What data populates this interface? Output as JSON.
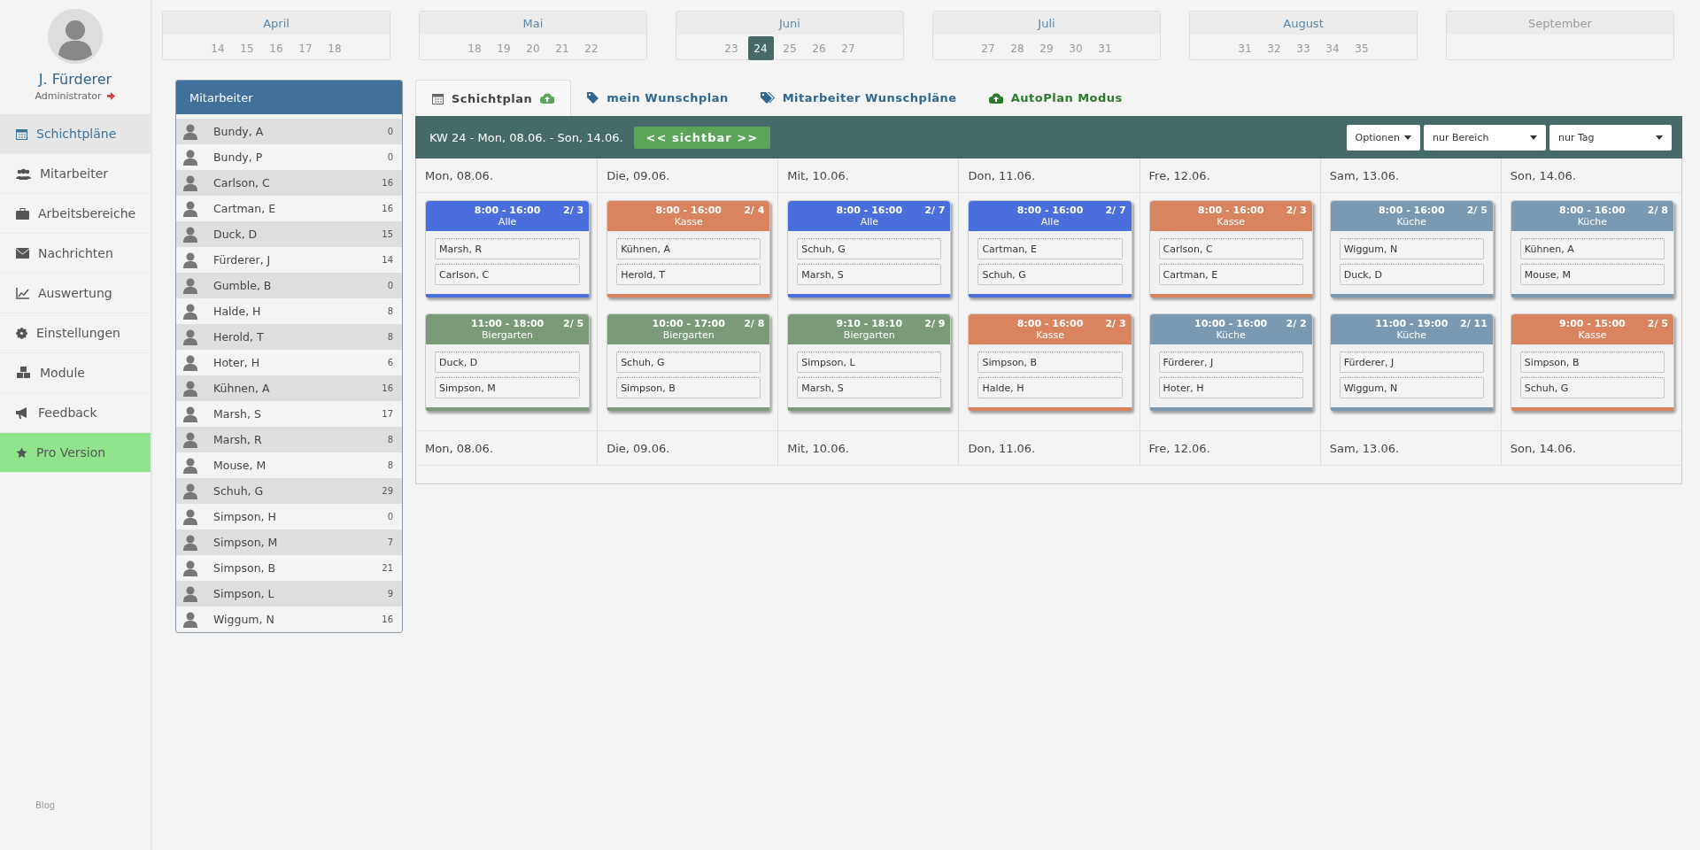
{
  "sidebar": {
    "user": {
      "name": "J. Fürderer",
      "role": "Administrator"
    },
    "nav": [
      {
        "label": "Schichtpläne",
        "selected": true,
        "kind": "normal"
      },
      {
        "label": "Mitarbeiter",
        "selected": false,
        "kind": "normal"
      },
      {
        "label": "Arbeitsbereiche",
        "selected": false,
        "kind": "normal"
      },
      {
        "label": "Nachrichten",
        "selected": false,
        "kind": "normal"
      },
      {
        "label": "Auswertung",
        "selected": false,
        "kind": "normal"
      },
      {
        "label": "Einstellungen",
        "selected": false,
        "kind": "normal"
      },
      {
        "label": "Module",
        "selected": false,
        "kind": "normal"
      },
      {
        "label": "Feedback",
        "selected": false,
        "kind": "normal"
      },
      {
        "label": "Pro Version",
        "selected": false,
        "kind": "promo"
      }
    ],
    "footer_link": "Blog"
  },
  "months": [
    {
      "name": "April",
      "weeks": [
        {
          "label": "14",
          "selected": false
        },
        {
          "label": "15",
          "selected": false
        },
        {
          "label": "16",
          "selected": false
        },
        {
          "label": "17",
          "selected": false
        },
        {
          "label": "18",
          "selected": false
        }
      ]
    },
    {
      "name": "Mai",
      "weeks": [
        {
          "label": "18",
          "selected": false
        },
        {
          "label": "19",
          "selected": false
        },
        {
          "label": "20",
          "selected": false
        },
        {
          "label": "21",
          "selected": false
        },
        {
          "label": "22",
          "selected": false
        }
      ]
    },
    {
      "name": "Juni",
      "weeks": [
        {
          "label": "23",
          "selected": false
        },
        {
          "label": "24",
          "selected": true
        },
        {
          "label": "25",
          "selected": false
        },
        {
          "label": "26",
          "selected": false
        },
        {
          "label": "27",
          "selected": false
        }
      ]
    },
    {
      "name": "Juli",
      "weeks": [
        {
          "label": "27",
          "selected": false
        },
        {
          "label": "28",
          "selected": false
        },
        {
          "label": "29",
          "selected": false
        },
        {
          "label": "30",
          "selected": false
        },
        {
          "label": "31",
          "selected": false
        }
      ]
    },
    {
      "name": "August",
      "weeks": [
        {
          "label": "31",
          "selected": false
        },
        {
          "label": "32",
          "selected": false
        },
        {
          "label": "33",
          "selected": false
        },
        {
          "label": "34",
          "selected": false
        },
        {
          "label": "35",
          "selected": false
        }
      ]
    },
    {
      "name": "September"
    }
  ],
  "staff": {
    "title": "Mitarbeiter",
    "rows": [
      {
        "name": "Bundy, A",
        "count": "0"
      },
      {
        "name": "Bundy, P",
        "count": "0"
      },
      {
        "name": "Carlson, C",
        "count": "16"
      },
      {
        "name": "Cartman, E",
        "count": "16"
      },
      {
        "name": "Duck, D",
        "count": "15"
      },
      {
        "name": "Fürderer, J",
        "count": "14"
      },
      {
        "name": "Gumble, B",
        "count": "0"
      },
      {
        "name": "Halde, H",
        "count": "8"
      },
      {
        "name": "Herold, T",
        "count": "8"
      },
      {
        "name": "Hoter, H",
        "count": "6"
      },
      {
        "name": "Kühnen, A",
        "count": "16"
      },
      {
        "name": "Marsh, S",
        "count": "17"
      },
      {
        "name": "Marsh, R",
        "count": "8"
      },
      {
        "name": "Mouse, M",
        "count": "8"
      },
      {
        "name": "Schuh, G",
        "count": "29"
      },
      {
        "name": "Simpson, H",
        "count": "0"
      },
      {
        "name": "Simpson, M",
        "count": "7"
      },
      {
        "name": "Simpson, B",
        "count": "21"
      },
      {
        "name": "Simpson, L",
        "count": "9"
      },
      {
        "name": "Wiggum, N",
        "count": "16"
      }
    ]
  },
  "tabs": [
    {
      "label": "Schichtplan",
      "selected": true,
      "kind": "view"
    },
    {
      "label": "mein Wunschplan",
      "selected": false,
      "kind": "view"
    },
    {
      "label": "Mitarbeiter Wunschpläne",
      "selected": false,
      "kind": "view"
    },
    {
      "label": "AutoPlan Modus",
      "selected": false,
      "kind": "action"
    }
  ],
  "toolbar": {
    "week": "KW 24 - Mon, 08.06. - Son, 14.06.",
    "visibility_button": "<< sichtbar >>",
    "options_button": "Optionen",
    "area_filter": "nur Bereich",
    "day_filter": "nur Tag"
  },
  "days": [
    {
      "header": "Mon, 08.06.",
      "footer": "Mon, 08.06.",
      "shifts": [
        {
          "time": "8:00 - 16:00",
          "count": "2/ 3",
          "area": "Alle",
          "color": "#4a6fdc",
          "staff": [
            "Marsh, R",
            "Carlson, C"
          ]
        },
        {
          "time": "11:00 - 18:00",
          "count": "2/ 5",
          "area": "Biergarten",
          "color": "#7b9a7a",
          "staff": [
            "Duck, D",
            "Simpson, M"
          ]
        }
      ]
    },
    {
      "header": "Die, 09.06.",
      "footer": "Die, 09.06.",
      "shifts": [
        {
          "time": "8:00 - 16:00",
          "count": "2/ 4",
          "area": "Kasse",
          "color": "#d9845e",
          "staff": [
            "Kühnen, A",
            "Herold, T"
          ]
        },
        {
          "time": "10:00 - 17:00",
          "count": "2/ 8",
          "area": "Biergarten",
          "color": "#7b9a7a",
          "staff": [
            "Schuh, G",
            "Simpson, B"
          ]
        }
      ]
    },
    {
      "header": "Mit, 10.06.",
      "footer": "Mit, 10.06.",
      "shifts": [
        {
          "time": "8:00 - 16:00",
          "count": "2/ 7",
          "area": "Alle",
          "color": "#4a6fdc",
          "staff": [
            "Schuh, G",
            "Marsh, S"
          ]
        },
        {
          "time": "9:10 - 18:10",
          "count": "2/ 9",
          "area": "Biergarten",
          "color": "#7b9a7a",
          "staff": [
            "Simpson, L",
            "Marsh, S"
          ]
        }
      ]
    },
    {
      "header": "Don, 11.06.",
      "footer": "Don, 11.06.",
      "shifts": [
        {
          "time": "8:00 - 16:00",
          "count": "2/ 7",
          "area": "Alle",
          "color": "#4a6fdc",
          "staff": [
            "Cartman, E",
            "Schuh, G"
          ]
        },
        {
          "time": "8:00 - 16:00",
          "count": "2/ 3",
          "area": "Kasse",
          "color": "#d9845e",
          "staff": [
            "Simpson, B",
            "Halde, H"
          ]
        }
      ]
    },
    {
      "header": "Fre, 12.06.",
      "footer": "Fre, 12.06.",
      "shifts": [
        {
          "time": "8:00 - 16:00",
          "count": "2/ 3",
          "area": "Kasse",
          "color": "#d9845e",
          "staff": [
            "Carlson, C",
            "Cartman, E"
          ]
        },
        {
          "time": "10:00 - 16:00",
          "count": "2/ 2",
          "area": "Küche",
          "color": "#7b99b0",
          "staff": [
            "Fürderer, J",
            "Hoter, H"
          ]
        }
      ]
    },
    {
      "header": "Sam, 13.06.",
      "footer": "Sam, 13.06.",
      "shifts": [
        {
          "time": "8:00 - 16:00",
          "count": "2/ 5",
          "area": "Küche",
          "color": "#7b99b0",
          "staff": [
            "Wiggum, N",
            "Duck, D"
          ]
        },
        {
          "time": "11:00 - 19:00",
          "count": "2/ 11",
          "area": "Küche",
          "color": "#7b99b0",
          "staff": [
            "Fürderer, J",
            "Wiggum, N"
          ]
        }
      ]
    },
    {
      "header": "Son, 14.06.",
      "footer": "Son, 14.06.",
      "shifts": [
        {
          "time": "8:00 - 16:00",
          "count": "2/ 8",
          "area": "Küche",
          "color": "#7b99b0",
          "staff": [
            "Kühnen, A",
            "Mouse, M"
          ]
        },
        {
          "time": "9:00 - 15:00",
          "count": "2/ 5",
          "area": "Kasse",
          "color": "#d9845e",
          "staff": [
            "Simpson, B",
            "Schuh, G"
          ]
        }
      ]
    }
  ]
}
